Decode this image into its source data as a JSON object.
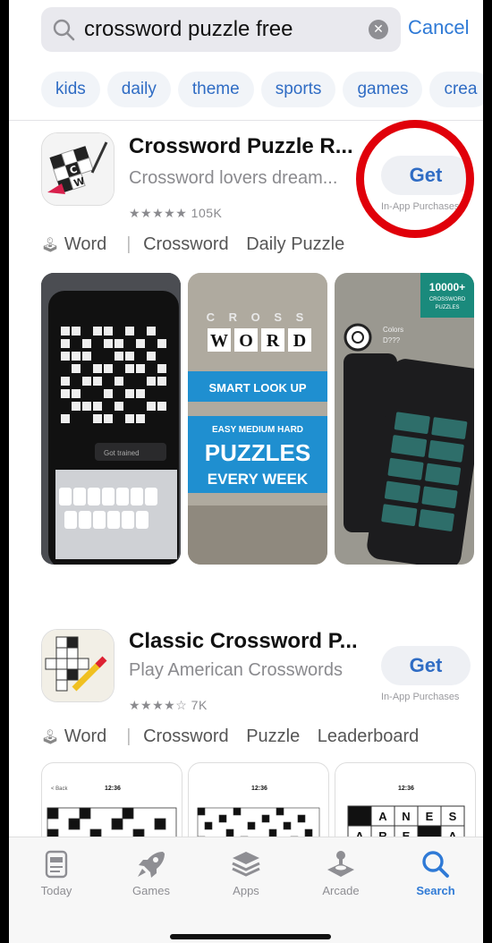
{
  "search": {
    "query": "crossword puzzle free",
    "cancel_label": "Cancel"
  },
  "chips": [
    "kids",
    "daily",
    "theme",
    "sports",
    "games",
    "crea"
  ],
  "apps": [
    {
      "title": "Crossword Puzzle R...",
      "subtitle": "Crossword lovers dream...",
      "stars": "★★★★★",
      "rating_count": "105K",
      "get_label": "Get",
      "iap_label": "In-App Purchases",
      "tags": [
        "Word",
        "Crossword",
        "Daily Puzzle"
      ],
      "screenshots": {
        "s1_line": "Got trained",
        "s1_keys1": "Q W E R T Y U",
        "s1_keys2": "A S D F G H",
        "s2_cross": "C R O S S",
        "s2_word": [
          "W",
          "O",
          "R",
          "D"
        ],
        "s2_smart": "SMART LOOK UP",
        "s2_levels": "EASY  MEDIUM  HARD",
        "s2_puzzles": "PUZZLES",
        "s2_every": "EVERY WEEK",
        "s3_badge": "10000+",
        "s3_badge_sub1": "CROSSWORD",
        "s3_badge_sub2": "PUZZLES",
        "s3_clue1": "Colors",
        "s3_clue2": "D???"
      }
    },
    {
      "title": "Classic Crossword P...",
      "subtitle": "Play American Crosswords",
      "stars": "★★★★☆",
      "rating_count": "7K",
      "get_label": "Get",
      "iap_label": "In-App Purchases",
      "tags": [
        "Word",
        "Crossword",
        "Puzzle",
        "Leaderboard"
      ],
      "screenshots": {
        "time1": "12:36",
        "time2": "12:36",
        "time3": "12:36",
        "back": "< Back",
        "row1": [
          "A",
          "N",
          "E",
          "S"
        ],
        "row2": [
          "A",
          "R",
          "E",
          "A"
        ]
      }
    }
  ],
  "tabbar": [
    {
      "label": "Today",
      "icon": "today-icon"
    },
    {
      "label": "Games",
      "icon": "rocket-icon"
    },
    {
      "label": "Apps",
      "icon": "layers-icon"
    },
    {
      "label": "Arcade",
      "icon": "joystick-icon"
    },
    {
      "label": "Search",
      "icon": "search-icon"
    }
  ],
  "colors": {
    "accent": "#2f7ad6",
    "highlight_circle": "#e0000a"
  }
}
